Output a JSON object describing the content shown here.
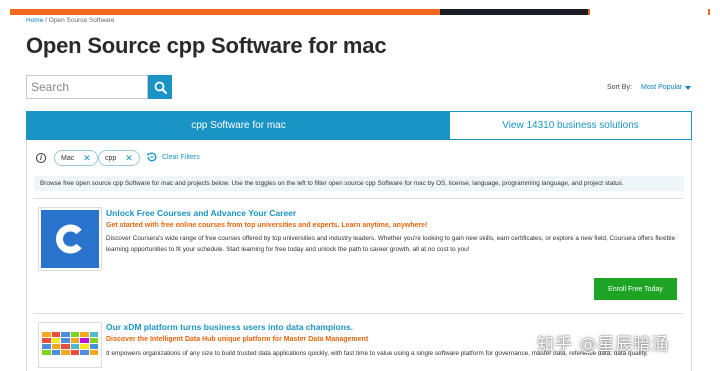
{
  "breadcrumb": {
    "home": "Home",
    "separator": "/",
    "current": "Open Source Software"
  },
  "page_title": "Open Source cpp Software for mac",
  "search": {
    "placeholder": "Search",
    "button_icon": "search-icon"
  },
  "sort": {
    "label": "Sort By:",
    "value": "Most Popular"
  },
  "tabs": [
    {
      "label": "cpp Software for mac",
      "active": true
    },
    {
      "label": "View 14310 business solutions",
      "active": false
    }
  ],
  "filters": {
    "chips": [
      {
        "label": "Mac"
      },
      {
        "label": "cpp"
      }
    ],
    "clear_label": "Clear Filters"
  },
  "description": "Browse free open source cpp Software for mac and projects below. Use the toggles on the left to filter open source cpp Software for mac by OS, license, language, programming language, and project status.",
  "ads": [
    {
      "title": "Unlock Free Courses and Advance Your Career",
      "subtitle": "Get started with free online courses from top universities and experts. Learn anytime, anywhere!",
      "body": "Discover Coursera's wide range of free courses offered by top universities and industry leaders. Whether you're looking to gain new skills, earn certificates, or explore a new field, Coursera offers flexible learning opportunities to fit your schedule. Start learning for free today and unlock the path to career growth, all at no cost to you!",
      "cta": "Enroll Free Today",
      "logo_letter": "C"
    },
    {
      "title": "Our xDM platform turns business users into data champions.",
      "subtitle": "Discover the Intelligent Data Hub unique platform for Master Data Management",
      "body": "It empowers organizations of any size to build trusted data applications quickly, with fast time to value using a single software platform for governance, master data, reference data, data quality,"
    }
  ],
  "watermark": "知乎 @星辰暗涌",
  "colors": {
    "accent": "#1a94c4",
    "link": "#0d82bd",
    "orange": "#e8650f",
    "topbar": "#f06a1e",
    "cta_green": "#1ea424",
    "coursera_blue": "#2a73cc"
  }
}
